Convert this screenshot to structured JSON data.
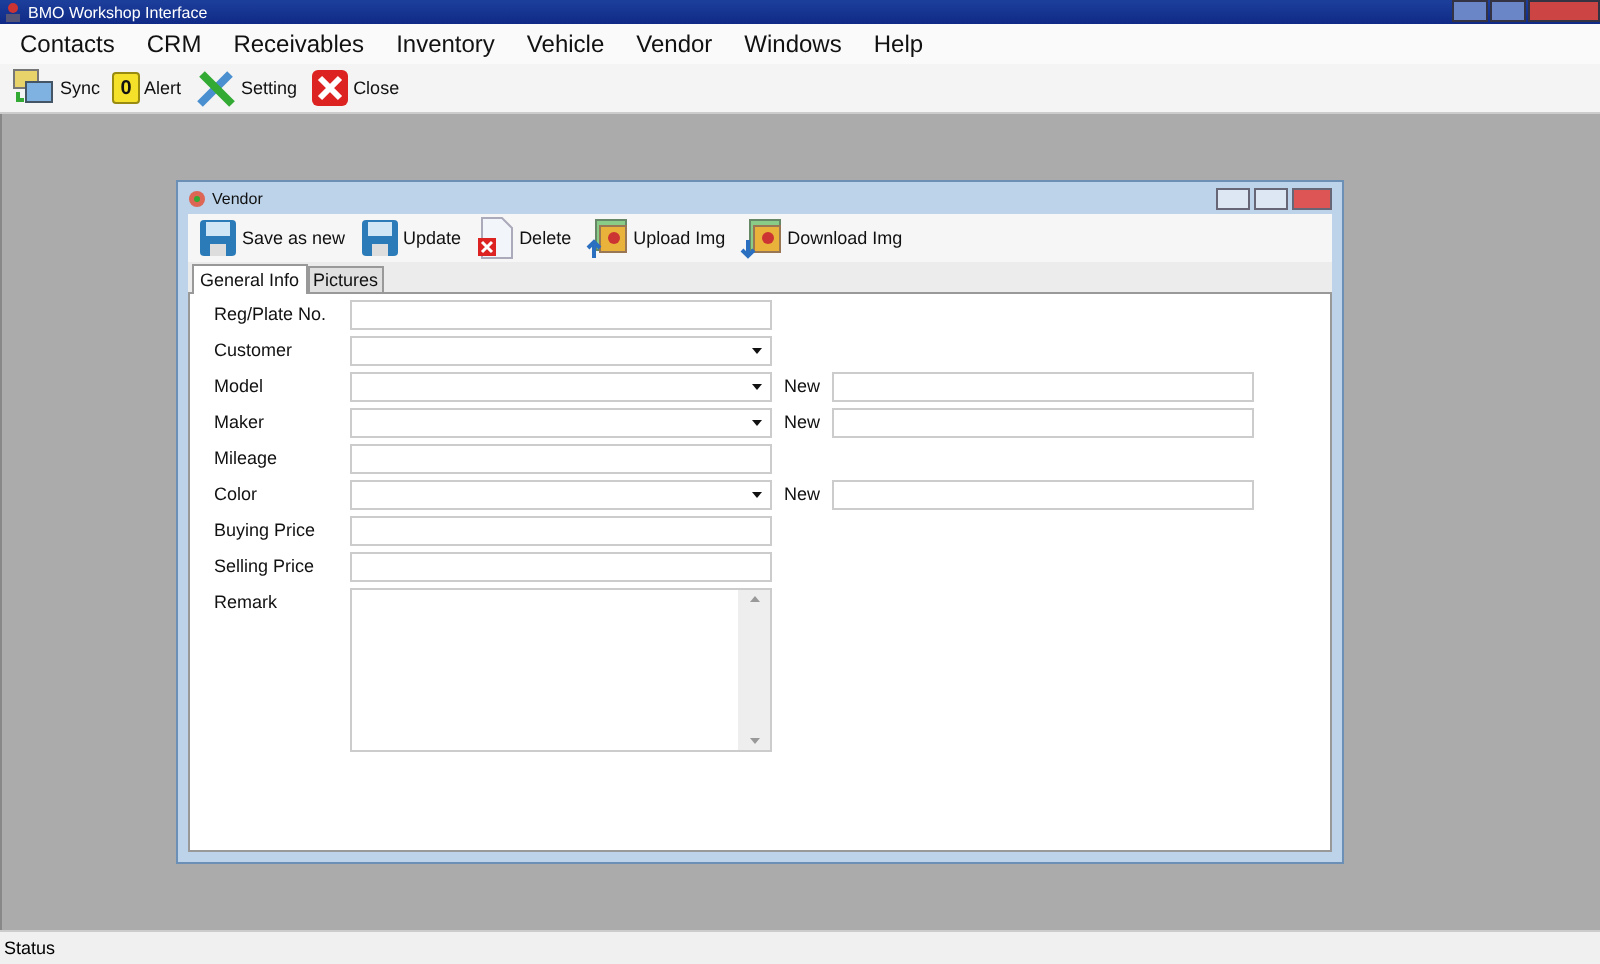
{
  "window": {
    "title": "BMO Workshop Interface"
  },
  "menu": [
    "Contacts",
    "CRM",
    "Receivables",
    "Inventory",
    "Vehicle",
    "Vendor",
    "Windows",
    "Help"
  ],
  "toolbar": [
    {
      "label": "Sync",
      "kind": "sync"
    },
    {
      "label": "Alert",
      "kind": "alert",
      "badge": "0"
    },
    {
      "label": "Setting",
      "kind": "setting"
    },
    {
      "label": "Close",
      "kind": "close"
    }
  ],
  "child": {
    "title": "Vendor",
    "toolbar": [
      {
        "label": "Save as new",
        "kind": "save"
      },
      {
        "label": "Update",
        "kind": "save"
      },
      {
        "label": "Delete",
        "kind": "delete"
      },
      {
        "label": "Upload Img",
        "kind": "upload"
      },
      {
        "label": "Download Img",
        "kind": "download"
      }
    ],
    "tabs": [
      {
        "label": "General Info",
        "selected": true
      },
      {
        "label": "Pictures",
        "selected": false
      }
    ],
    "fields": [
      {
        "label": "Reg/Plate No.",
        "kind": "text"
      },
      {
        "label": "Customer",
        "kind": "combo"
      },
      {
        "label": "Model",
        "kind": "combo",
        "new_label": "New"
      },
      {
        "label": "Maker",
        "kind": "combo",
        "new_label": "New"
      },
      {
        "label": "Mileage",
        "kind": "text"
      },
      {
        "label": "Color",
        "kind": "combo",
        "new_label": "New"
      },
      {
        "label": "Buying Price",
        "kind": "text"
      },
      {
        "label": "Selling Price",
        "kind": "text"
      },
      {
        "label": "Remark",
        "kind": "memo"
      }
    ]
  },
  "status_bar": "Status"
}
